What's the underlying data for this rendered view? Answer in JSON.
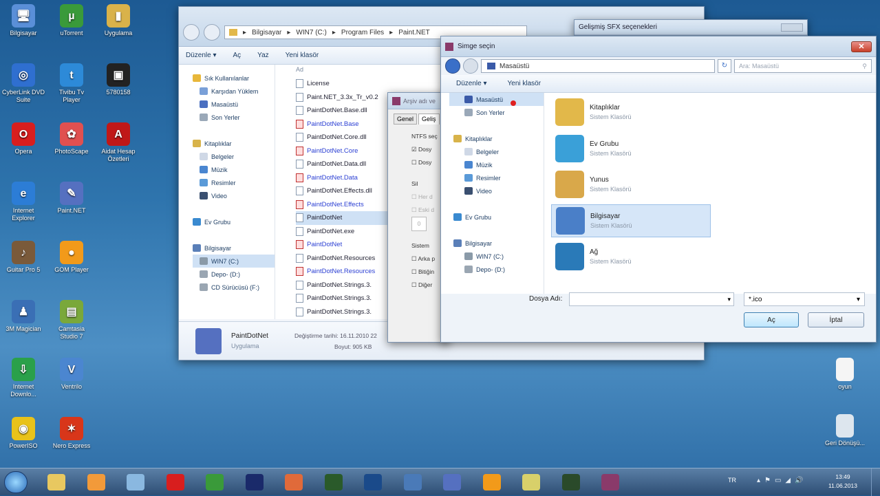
{
  "desktop_icons": [
    {
      "label": "Bilgisayar",
      "color": "#5a8fd8",
      "glyph": "🖥"
    },
    {
      "label": "uTorrent",
      "color": "#3a9a3a",
      "glyph": "µ"
    },
    {
      "label": "Uygulama",
      "color": "#d9b24a",
      "glyph": "▮"
    },
    {
      "label": "CyberLink DVD Suite",
      "color": "#2f6fd0",
      "glyph": "◎"
    },
    {
      "label": "Tivibu Tv Player",
      "color": "#2d8ad8",
      "glyph": "t"
    },
    {
      "label": "5780158",
      "color": "#222",
      "glyph": "▣"
    },
    {
      "label": "Opera",
      "color": "#d81e1e",
      "glyph": "O"
    },
    {
      "label": "PhotoScape",
      "color": "#e05050",
      "glyph": "✿"
    },
    {
      "label": "Aidat Hesap Özetleri",
      "color": "#c01818",
      "glyph": "A"
    },
    {
      "label": "Internet Explorer",
      "color": "#2c7dd6",
      "glyph": "e"
    },
    {
      "label": "Paint.NET",
      "color": "#5570c0",
      "glyph": "✎"
    },
    {
      "label": "Guitar Pro 5",
      "color": "#7a5a3a",
      "glyph": "♪"
    },
    {
      "label": "GOM Player",
      "color": "#f29a1a",
      "glyph": "●"
    },
    {
      "label": "3M Magician",
      "color": "#3a6fb5",
      "glyph": "♟"
    },
    {
      "label": "Camtasia Studio 7",
      "color": "#7aa83a",
      "glyph": "▤"
    },
    {
      "label": "Internet Downlo...",
      "color": "#2aa04a",
      "glyph": "⇩"
    },
    {
      "label": "Ventrilo",
      "color": "#4b86d0",
      "glyph": "V"
    },
    {
      "label": "PowerISO",
      "color": "#e8c21a",
      "glyph": "◉"
    },
    {
      "label": "Nero Express",
      "color": "#d8361a",
      "glyph": "✶"
    }
  ],
  "right_icons": [
    {
      "label": "oyun",
      "color": "#f5f5f5"
    },
    {
      "label": "Geri Dönüşü...",
      "color": "#dde6ee"
    }
  ],
  "explorer": {
    "breadcrumb": [
      "Bilgisayar",
      "WIN7 (C:)",
      "Program Files",
      "Paint.NET"
    ],
    "toolbar": [
      "Düzenle ▾",
      "Aç",
      "Yaz",
      "Yeni klasör"
    ],
    "nav": [
      {
        "label": "Sık Kullanılanlar",
        "color": "#e8b73a",
        "indent": 0
      },
      {
        "label": "Karşıdan Yüklem",
        "color": "#7aa0d8",
        "indent": 1
      },
      {
        "label": "Masaüstü",
        "color": "#4a6fc0",
        "indent": 1
      },
      {
        "label": "Son Yerler",
        "color": "#9aa8b8",
        "indent": 1
      },
      {
        "label": "",
        "color": "transparent",
        "indent": 0
      },
      {
        "label": "Kitaplıklar",
        "color": "#d8b34a",
        "indent": 0
      },
      {
        "label": "Belgeler",
        "color": "#cfd8e6",
        "indent": 1
      },
      {
        "label": "Müzik",
        "color": "#4a86d0",
        "indent": 1
      },
      {
        "label": "Resimler",
        "color": "#5a9ad8",
        "indent": 1
      },
      {
        "label": "Video",
        "color": "#3a4f70",
        "indent": 1
      },
      {
        "label": "",
        "color": "transparent",
        "indent": 0
      },
      {
        "label": "Ev Grubu",
        "color": "#3a8ad0",
        "indent": 0
      },
      {
        "label": "",
        "color": "transparent",
        "indent": 0
      },
      {
        "label": "Bilgisayar",
        "color": "#5a7fb8",
        "indent": 0
      },
      {
        "label": "WIN7 (C:)",
        "color": "#8a9aa8",
        "indent": 1
      },
      {
        "label": "Depo- (D:)",
        "color": "#9aa6b2",
        "indent": 1
      },
      {
        "label": "CD Sürücüsü (F:)",
        "color": "#9aa6b2",
        "indent": 1
      }
    ],
    "column_header": "Ad",
    "files": [
      {
        "name": "License",
        "type": "doc",
        "blue": false,
        "sel": false
      },
      {
        "name": "Paint.NET_3.3x_Tr_v0.2",
        "type": "doc",
        "blue": false,
        "sel": false
      },
      {
        "name": "PaintDotNet.Base.dll",
        "type": "doc",
        "blue": false,
        "sel": false
      },
      {
        "name": "PaintDotNet.Base",
        "type": "red",
        "blue": true,
        "sel": false
      },
      {
        "name": "PaintDotNet.Core.dll",
        "type": "doc",
        "blue": false,
        "sel": false
      },
      {
        "name": "PaintDotNet.Core",
        "type": "red",
        "blue": true,
        "sel": false
      },
      {
        "name": "PaintDotNet.Data.dll",
        "type": "doc",
        "blue": false,
        "sel": false
      },
      {
        "name": "PaintDotNet.Data",
        "type": "red",
        "blue": true,
        "sel": false
      },
      {
        "name": "PaintDotNet.Effects.dll",
        "type": "doc",
        "blue": false,
        "sel": false
      },
      {
        "name": "PaintDotNet.Effects",
        "type": "red",
        "blue": true,
        "sel": false
      },
      {
        "name": "PaintDotNet",
        "type": "doc",
        "blue": false,
        "sel": true
      },
      {
        "name": "PaintDotNet.exe",
        "type": "doc",
        "blue": false,
        "sel": false
      },
      {
        "name": "PaintDotNet",
        "type": "red",
        "blue": true,
        "sel": false
      },
      {
        "name": "PaintDotNet.Resources",
        "type": "doc",
        "blue": false,
        "sel": false
      },
      {
        "name": "PaintDotNet.Resources",
        "type": "red",
        "blue": true,
        "sel": false
      },
      {
        "name": "PaintDotNet.Strings.3.",
        "type": "doc",
        "blue": false,
        "sel": false
      },
      {
        "name": "PaintDotNet.Strings.3.",
        "type": "doc",
        "blue": false,
        "sel": false
      },
      {
        "name": "PaintDotNet.Strings.3.",
        "type": "doc",
        "blue": false,
        "sel": false
      }
    ],
    "details": {
      "name": "PaintDotNet",
      "kind": "Uygulama",
      "modified_label": "Değiştirme tarihi:",
      "modified": "16.11.2010 22",
      "size_label": "Boyut:",
      "size": "905 KB"
    }
  },
  "archive_dialog": {
    "title": "Arşiv adı ve",
    "tabs": [
      "Genel",
      "Geliş"
    ],
    "group1": "NTFS seç",
    "cb1": "Dosy",
    "cb2": "Dosy",
    "group2": "Sil",
    "cb3": "Her d",
    "cb4": "Eski d",
    "spin": "0",
    "group3": "Sistem",
    "cb5": "Arka p",
    "cb6": "Bitiğin",
    "cb7": "Diğer"
  },
  "sfx_title": "Gelişmiş SFX seçenekleri",
  "icon_dialog": {
    "title": "Simge seçin",
    "location": "Masaüstü",
    "search_placeholder": "Ara: Masaüstü",
    "toolbar": [
      "Düzenle ▾",
      "Yeni klasör"
    ],
    "nav": [
      {
        "label": "Masaüstü",
        "color": "#3a5aa8",
        "indent": 1,
        "sel": true
      },
      {
        "label": "Son Yerler",
        "color": "#9aa8b8",
        "indent": 1,
        "sel": false
      },
      {
        "label": "",
        "color": "transparent",
        "indent": 0,
        "sel": false
      },
      {
        "label": "Kitaplıklar",
        "color": "#d8b34a",
        "indent": 0,
        "sel": false
      },
      {
        "label": "Belgeler",
        "color": "#cfd8e6",
        "indent": 1,
        "sel": false
      },
      {
        "label": "Müzik",
        "color": "#4a86d0",
        "indent": 1,
        "sel": false
      },
      {
        "label": "Resimler",
        "color": "#5a9ad8",
        "indent": 1,
        "sel": false
      },
      {
        "label": "Video",
        "color": "#3a4f70",
        "indent": 1,
        "sel": false
      },
      {
        "label": "",
        "color": "transparent",
        "indent": 0,
        "sel": false
      },
      {
        "label": "Ev Grubu",
        "color": "#3a8ad0",
        "indent": 0,
        "sel": false
      },
      {
        "label": "",
        "color": "transparent",
        "indent": 0,
        "sel": false
      },
      {
        "label": "Bilgisayar",
        "color": "#5a7fb8",
        "indent": 0,
        "sel": false
      },
      {
        "label": "WIN7 (C:)",
        "color": "#8a9aa8",
        "indent": 1,
        "sel": false
      },
      {
        "label": "Depo- (D:)",
        "color": "#9aa6b2",
        "indent": 1,
        "sel": false
      }
    ],
    "items": [
      {
        "name": "Kitaplıklar",
        "sub": "Sistem Klasörü",
        "color": "#e2b84a",
        "sel": false
      },
      {
        "name": "Ev Grubu",
        "sub": "Sistem Klasörü",
        "color": "#3aa0d8",
        "sel": false
      },
      {
        "name": "Yunus",
        "sub": "Sistem Klasörü",
        "color": "#d9a84a",
        "sel": false
      },
      {
        "name": "Bilgisayar",
        "sub": "Sistem Klasörü",
        "color": "#4a7fc8",
        "sel": true
      },
      {
        "name": "Ağ",
        "sub": "Sistem Klasörü",
        "color": "#2a7ab8",
        "sel": false
      }
    ],
    "filename_label": "Dosya Adı:",
    "filetype": "*.ico",
    "open_button": "Aç",
    "cancel_button": "İptal"
  },
  "taskbar": {
    "apps": [
      {
        "name": "explorer",
        "color": "#e8c860"
      },
      {
        "name": "media-player",
        "color": "#f29a3a"
      },
      {
        "name": "snipping",
        "color": "#8ab8e0"
      },
      {
        "name": "opera",
        "color": "#d81e1e"
      },
      {
        "name": "utorrent",
        "color": "#3a9a3a"
      },
      {
        "name": "divx",
        "color": "#1a2a6a"
      },
      {
        "name": "photoscape",
        "color": "#e06a3a"
      },
      {
        "name": "dreamweaver",
        "color": "#2a5a2a"
      },
      {
        "name": "photoshop",
        "color": "#1a4a8a"
      },
      {
        "name": "nod",
        "color": "#4a7ab8"
      },
      {
        "name": "paintnet",
        "color": "#5570c0"
      },
      {
        "name": "gom",
        "color": "#f29a1a"
      },
      {
        "name": "notes",
        "color": "#d8d06a"
      },
      {
        "name": "winrar-sfx",
        "color": "#2a4a2a"
      },
      {
        "name": "winrar",
        "color": "#8a3a6a"
      }
    ],
    "language": "TR",
    "time": "13:49",
    "date": "11.06.2013"
  }
}
